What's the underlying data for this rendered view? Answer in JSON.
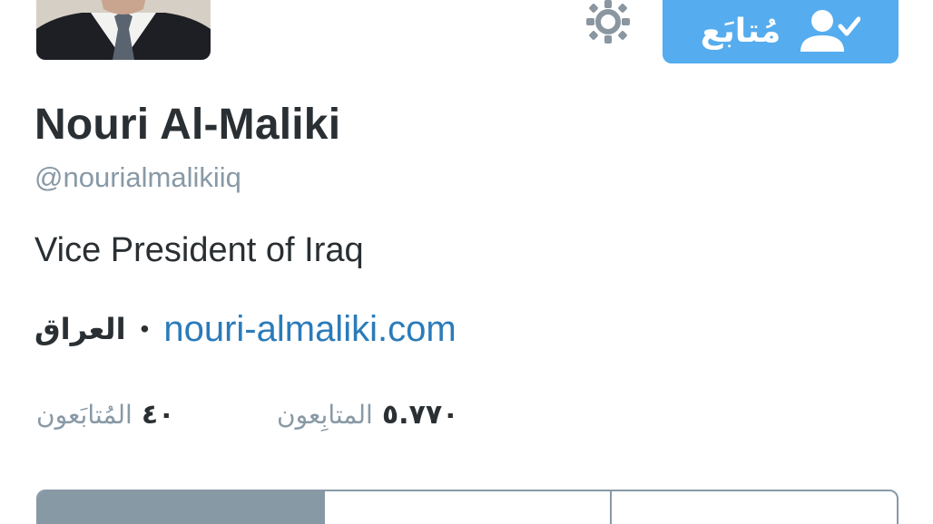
{
  "profile": {
    "display_name": "Nouri Al-Maliki",
    "handle": "@nourialmalikiiq",
    "bio": "Vice President of Iraq",
    "location": "العراق",
    "separator": "•",
    "website": "nouri-almaliki.com"
  },
  "follow_button": {
    "label": "مُتابَع",
    "icon": "user-check-icon",
    "color": "#55acee"
  },
  "settings": {
    "icon": "gear-icon"
  },
  "stats": {
    "following": {
      "count": "٤٠",
      "label": "المُتابَعون"
    },
    "followers": {
      "count": "٥.٧٧٠",
      "label": "المتابِعون"
    }
  },
  "tabs": [
    {
      "label": ""
    },
    {
      "label": ""
    },
    {
      "label": ""
    }
  ],
  "colors": {
    "accent": "#55acee",
    "link": "#2b7bb9",
    "text": "#292f33",
    "muted": "#8899a6"
  }
}
